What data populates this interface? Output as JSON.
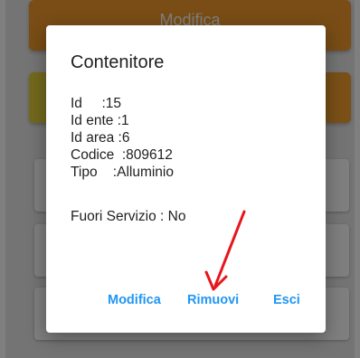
{
  "background": {
    "orange_button_label": "Modifica"
  },
  "dialog": {
    "title": "Contenitore",
    "fields": [
      "Id     :15",
      "Id ente :1",
      "Id area :6",
      "Codice  :809612",
      "Tipo    :Alluminio"
    ],
    "status": "Fuori Servizio : No",
    "actions": {
      "edit_label": "Modifica",
      "remove_label": "Rimuovi",
      "exit_label": "Esci"
    }
  },
  "colors": {
    "accent": "#2196f3",
    "annotation_arrow": "#e8141c"
  }
}
